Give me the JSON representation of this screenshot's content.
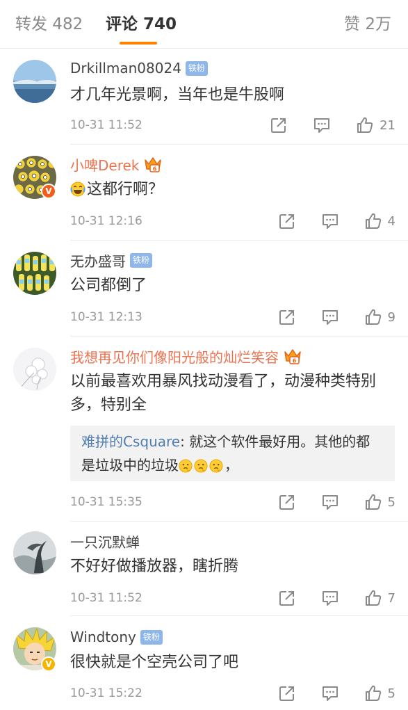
{
  "tabs": {
    "repost": "转发 482",
    "comments": "评论 740",
    "likes": "赞 2万",
    "active": "comments"
  },
  "colors": {
    "accent": "#ff8200",
    "vip_name": "#eb7350",
    "reply_author": "#507daf",
    "fan_badge": "#8fb6ea"
  },
  "comments": [
    {
      "username": "Drkillman08024",
      "badge": "铁粉",
      "text": "才几年光景啊，当年也是牛股啊",
      "time": "10-31 11:52",
      "likes": "21"
    },
    {
      "username": "小啤Derek",
      "badge_icon": "vip-crown-icon",
      "verified": "orange-v",
      "emoji": "laughing-tears-emoji",
      "text": "这都行啊？",
      "time": "10-31 12:16",
      "likes": "4"
    },
    {
      "username": "无办盛哥",
      "badge": "铁粉",
      "text": "公司都倒了",
      "time": "10-31 12:13",
      "likes": "9"
    },
    {
      "username": "我想再见你们像阳光般的灿烂笑容",
      "badge_icon": "vip-crown-icon",
      "text": "以前最喜欢用暴风找动漫看了，动漫种类特别多，特别全",
      "reply": {
        "author": "难拼的Csquare",
        "text": "就这个软件最好用。其他的都是垃圾中的垃圾",
        "emoji": "thinking-emoji",
        "suffix": "，"
      },
      "time": "10-31 15:35",
      "likes": "5"
    },
    {
      "username": "一只沉默蝉",
      "text": "不好好做播放器，瞎折腾",
      "time": "10-31 11:52",
      "likes": "7"
    },
    {
      "username": "Windtony",
      "badge": "铁粉",
      "verified": "yellow-v",
      "text": "很快就是个空壳公司了吧",
      "time": "10-31 15:22",
      "likes": "5"
    }
  ]
}
